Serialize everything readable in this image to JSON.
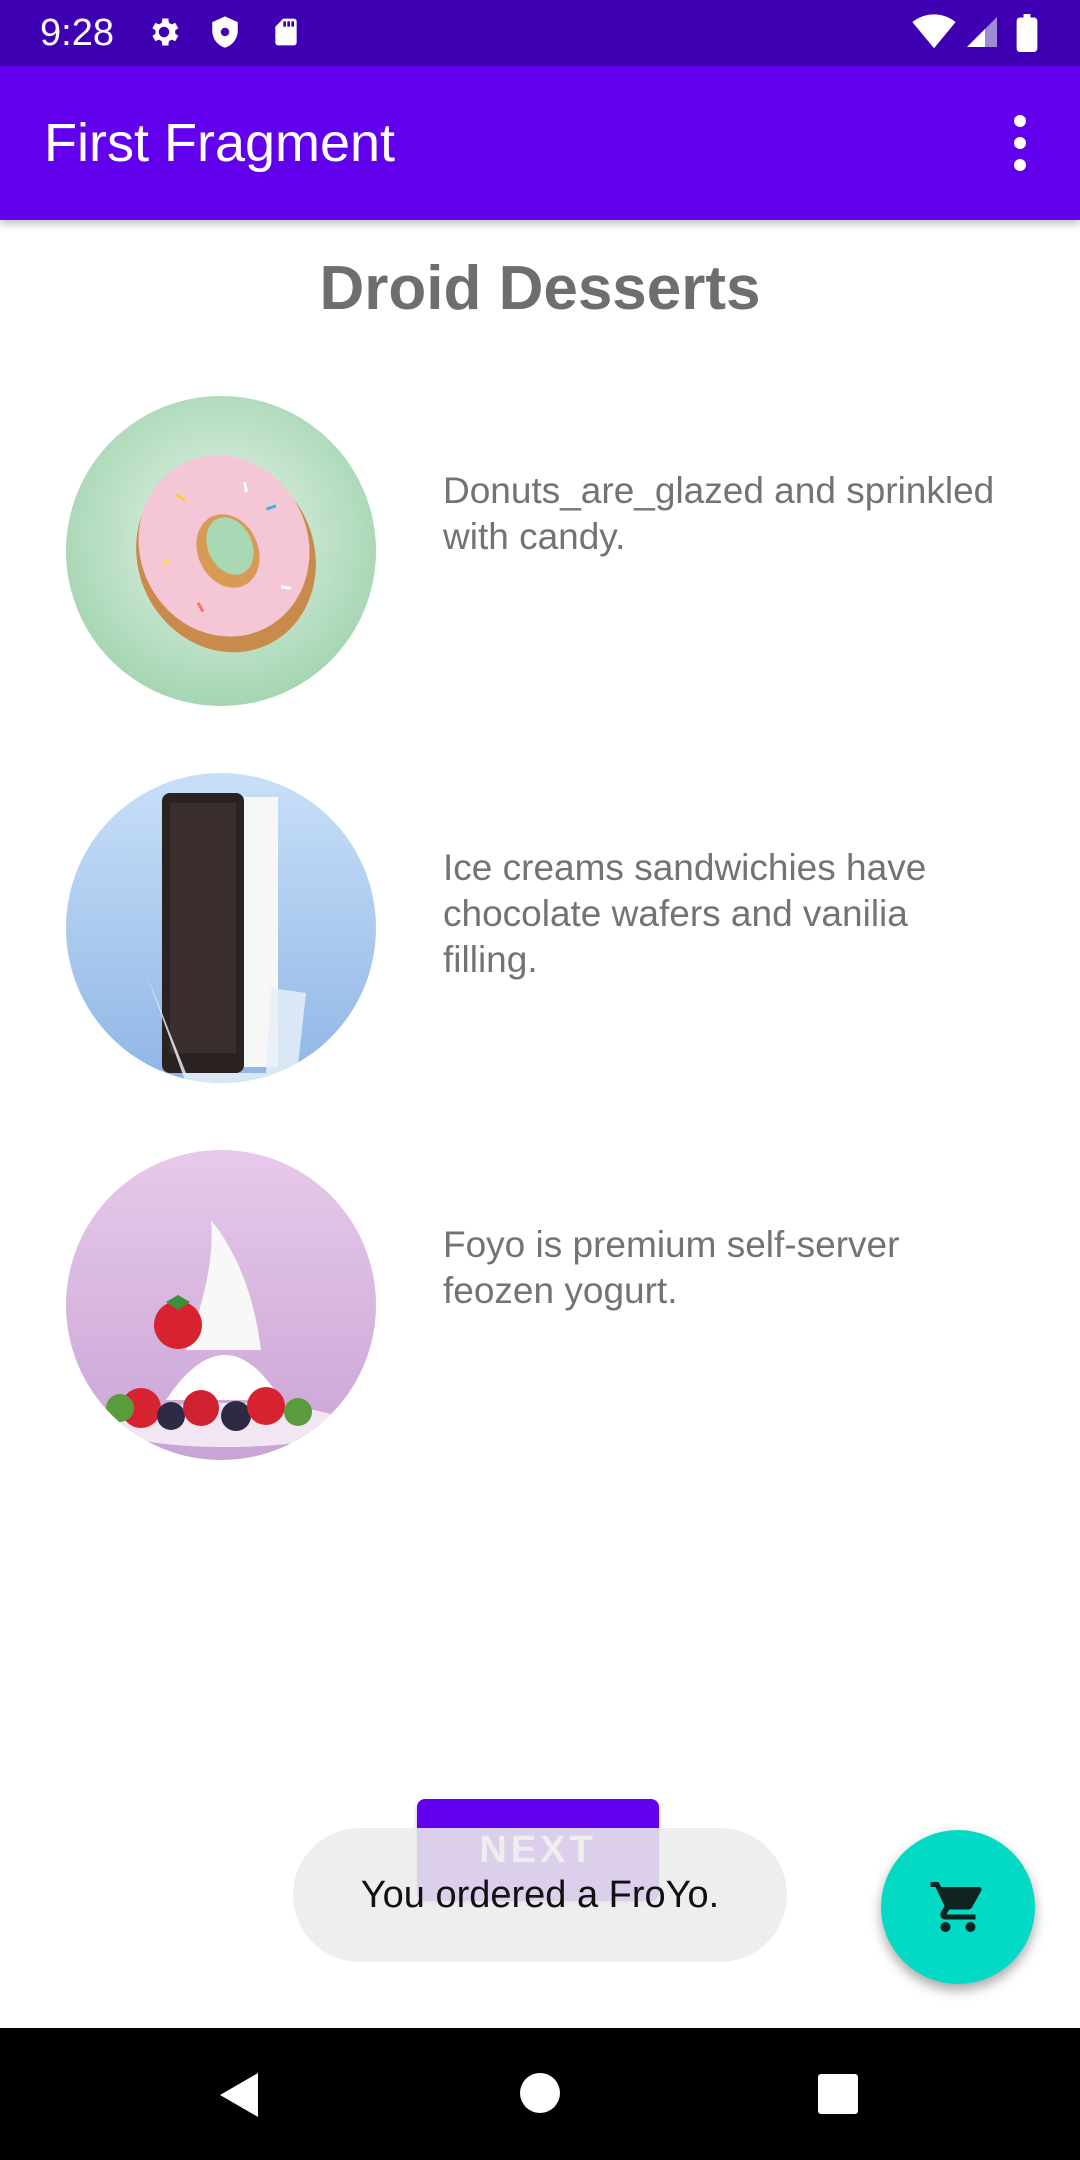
{
  "status_bar": {
    "time": "9:28",
    "icons": [
      "gear-icon",
      "shield-icon",
      "sd-card-icon",
      "wifi-icon",
      "signal-icon",
      "battery-icon"
    ]
  },
  "app_bar": {
    "title": "First Fragment",
    "menu_icon": "more-vert-icon"
  },
  "main": {
    "title": "Droid Desserts",
    "desserts": [
      {
        "image": "donut",
        "description": "Donuts_are_glazed and sprinkled with candy."
      },
      {
        "image": "ice-cream-sandwich",
        "description": "Ice creams sandwichies have chocolate wafers and vanilia filling."
      },
      {
        "image": "froyo",
        "description": "Foyo is premium self-server feozen yogurt."
      }
    ],
    "next_label": "NEXT"
  },
  "toast": {
    "text": "You ordered a FroYo."
  },
  "fab": {
    "icon": "shopping-cart-icon",
    "color": "#03dac5"
  },
  "colors": {
    "primary": "#6200ee",
    "primary_dark": "#3f00b3",
    "accent": "#03dac5"
  },
  "nav_bar": {
    "icons": [
      "back-icon",
      "home-icon",
      "recents-icon"
    ]
  }
}
